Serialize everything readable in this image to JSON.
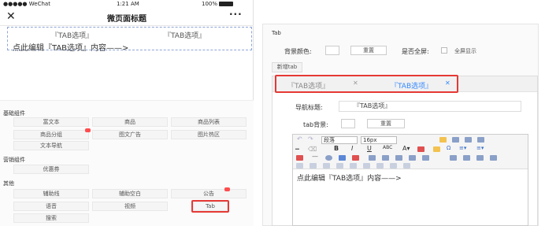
{
  "status_bar": {
    "carrier": "●●●●● WeChat",
    "time": "1:21 AM",
    "battery": "100%"
  },
  "nav": {
    "close": "✕",
    "title": "微页面标题",
    "more": "···"
  },
  "preview": {
    "tab1": "『TAB选项』",
    "tab2": "『TAB选项』",
    "content": "点此编辑『TAB选项』内容——>"
  },
  "components": {
    "basic_title": "基础组件",
    "basic": [
      "富文本",
      "商品",
      "商品列表",
      "商品分组",
      "图文广告",
      "图片热区",
      "文本导航"
    ],
    "marketing_title": "营销组件",
    "marketing": [
      "优惠券"
    ],
    "other_title": "其他",
    "other": [
      "辅助线",
      "辅助空白",
      "公告",
      "语音",
      "视频",
      "Tab",
      "搜索"
    ]
  },
  "editor": {
    "title": "Tab",
    "bg_color_label": "背景颜色:",
    "reset": "重置",
    "fullscreen_label": "是否全屏:",
    "fullscreen_option": "全屏显示",
    "add_tab": "新增tab",
    "tabs": [
      "『TAB选项』",
      "『TAB选项』"
    ],
    "tab_close": "✕",
    "nav_title_label": "导航标题:",
    "nav_title_value": "『TAB选项』",
    "tab_bg_label": "tab背景:",
    "reset2": "重置"
  },
  "rte": {
    "paragraph": "段落",
    "font_size": "16px",
    "content": "点此编辑『TAB选项』内容——>"
  },
  "colors": {
    "accent": "#38f",
    "highlight": "#e53935",
    "badge": "#ff4d4f"
  }
}
